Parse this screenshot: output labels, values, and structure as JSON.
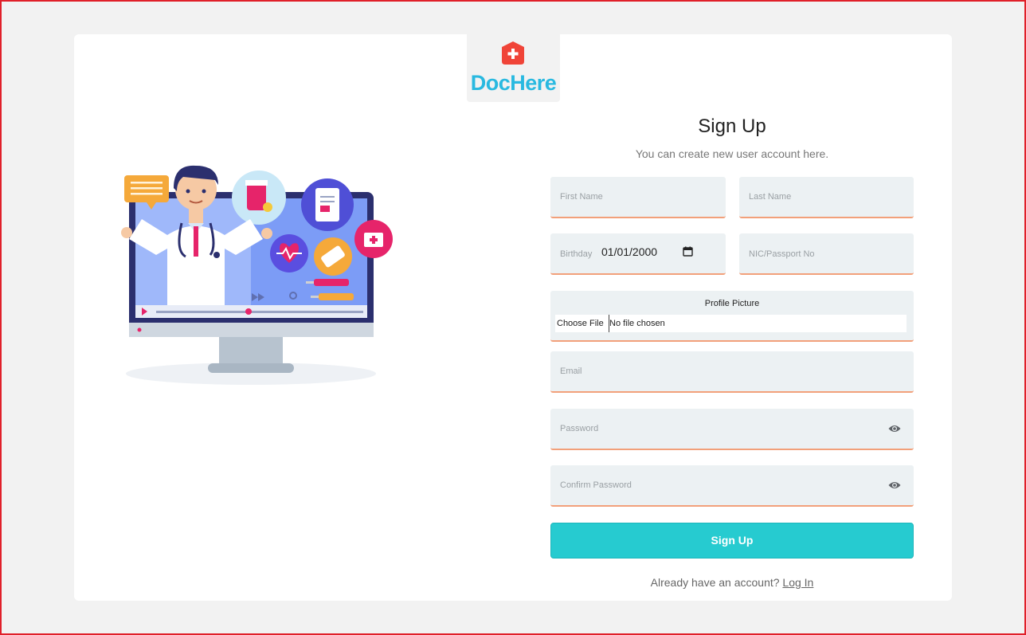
{
  "brand": {
    "name": "DocHere",
    "color": "#29b9e0",
    "icon": "medical-cross-icon",
    "icon_color": "#f04438"
  },
  "form": {
    "title": "Sign Up",
    "subtitle": "You can create new user account here.",
    "first_name": {
      "placeholder": "First Name"
    },
    "last_name": {
      "placeholder": "Last Name"
    },
    "birthday": {
      "label": "Birthday",
      "value": "01/01/2000",
      "icon": "calendar-icon"
    },
    "nic": {
      "placeholder": "NIC/Passport No"
    },
    "profile_picture": {
      "label": "Profile Picture",
      "button": "Choose File",
      "status": "No file chosen"
    },
    "email": {
      "placeholder": "Email"
    },
    "password": {
      "placeholder": "Password",
      "icon": "eye-icon"
    },
    "confirm_password": {
      "placeholder": "Confirm Password",
      "icon": "eye-icon"
    },
    "submit_label": "Sign Up",
    "submit_color": "#26cbd0"
  },
  "footer": {
    "prompt": "Already have an account?",
    "link": "Log In"
  },
  "colors": {
    "frame_border": "#e0202a",
    "field_bg": "#ecf1f3",
    "field_underline": "#f2a07a"
  }
}
